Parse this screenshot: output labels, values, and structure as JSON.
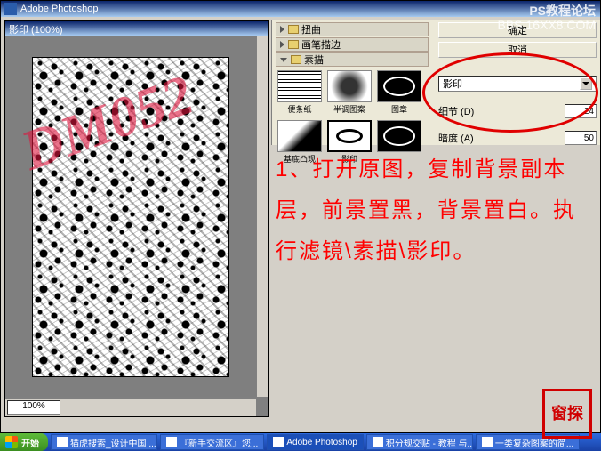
{
  "app": {
    "title": "Adobe Photoshop"
  },
  "doc": {
    "title": "影印 (100%)",
    "zoom": "100%"
  },
  "watermark_canvas": "DM052",
  "watermark_top": {
    "line1": "PS教程论坛",
    "line2": "BBS.16XX8.COM"
  },
  "filter": {
    "categories": [
      {
        "label": "扭曲",
        "open": false
      },
      {
        "label": "画笔描边",
        "open": false
      },
      {
        "label": "素描",
        "open": true
      }
    ],
    "thumbs": [
      {
        "label": "便条纸",
        "cls": "th-stripes"
      },
      {
        "label": "半调图案",
        "cls": "th-halftone"
      },
      {
        "label": "图章",
        "cls": "th-stamp"
      },
      {
        "label": "基底凸现",
        "cls": "th-photo"
      },
      {
        "label": "影印",
        "cls": "th-photocopy",
        "selected": true
      },
      {
        "label": "",
        "cls": "th-stamp"
      }
    ],
    "buttons": {
      "ok": "确定",
      "cancel": "取消"
    },
    "dropdown": "影印",
    "sliders": [
      {
        "label": "细节 (D)",
        "value": "24"
      },
      {
        "label": "暗度 (A)",
        "value": "50"
      }
    ]
  },
  "instruction": "1、打开原图，复制背景副本层，前景置黑，背景置白。执行滤镜\\素描\\影印。",
  "seal": "窗探",
  "taskbar": {
    "start": "开始",
    "items": [
      "猫虎搜索_设计中国 ...",
      "『新手交流区』您...",
      "Adobe Photoshop",
      "积分规交贴 - 教程 与...",
      "一类复杂图案的简..."
    ],
    "active_index": 2
  }
}
